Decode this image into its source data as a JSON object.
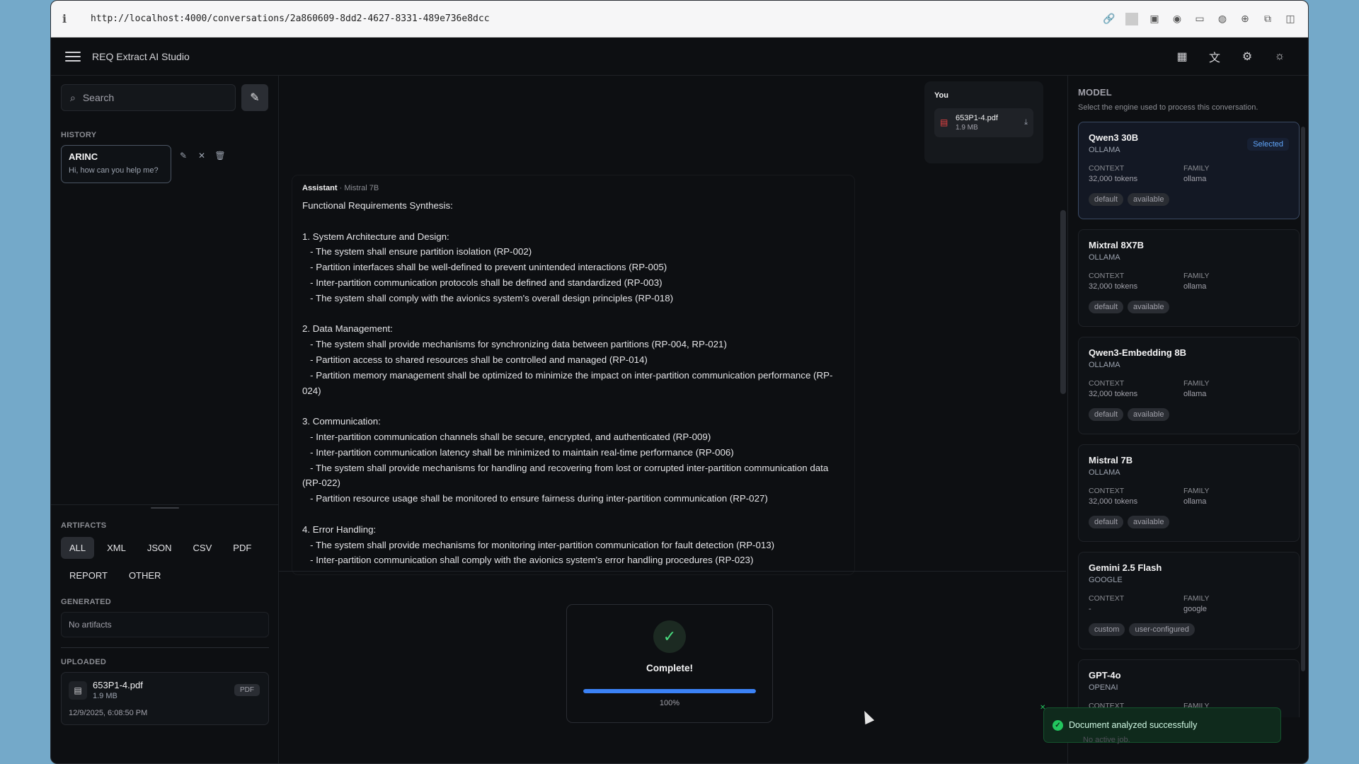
{
  "browser": {
    "url": "http://localhost:4000/conversations/2a860609-8dd2-4627-8331-489e736e8dcc"
  },
  "app": {
    "title": "REQ Extract AI Studio"
  },
  "sidebar": {
    "search_placeholder": "Search",
    "history_label": "HISTORY",
    "history": [
      {
        "title": "ARINC",
        "subtitle": "Hi, how can you help me?"
      }
    ],
    "artifacts_label": "ARTIFACTS",
    "filters": [
      "ALL",
      "XML",
      "JSON",
      "CSV",
      "PDF",
      "REPORT",
      "OTHER"
    ],
    "generated_label": "GENERATED",
    "generated_empty": "No artifacts",
    "uploaded_label": "UPLOADED",
    "uploaded": {
      "name": "653P1-4.pdf",
      "size": "1.9 MB",
      "type": "PDF",
      "date": "12/9/2025, 6:08:50 PM"
    }
  },
  "chat": {
    "you_label": "You",
    "attachment": {
      "name": "653P1-4.pdf",
      "size": "1.9 MB"
    },
    "assistant_label": "Assistant",
    "assistant_model": "· Mistral 7B",
    "assistant_text": "Functional Requirements Synthesis:\n\n1. System Architecture and Design:\n   - The system shall ensure partition isolation (RP-002)\n   - Partition interfaces shall be well-defined to prevent unintended interactions (RP-005)\n   - Inter-partition communication protocols shall be defined and standardized (RP-003)\n   - The system shall comply with the avionics system's overall design principles (RP-018)\n\n2. Data Management:\n   - The system shall provide mechanisms for synchronizing data between partitions (RP-004, RP-021)\n   - Partition access to shared resources shall be controlled and managed (RP-014)\n   - Partition memory management shall be optimized to minimize the impact on inter-partition communication performance (RP-024)\n\n3. Communication:\n   - Inter-partition communication channels shall be secure, encrypted, and authenticated (RP-009)\n   - Inter-partition communication latency shall be minimized to maintain real-time performance (RP-006)\n   - The system shall provide mechanisms for handling and recovering from lost or corrupted inter-partition communication data (RP-022)\n   - Partition resource usage shall be monitored to ensure fairness during inter-partition communication (RP-027)\n\n4. Error Handling:\n   - The system shall provide mechanisms for monitoring inter-partition communication for fault detection (RP-013)\n   - Inter-partition communication shall comply with the avionics system's error handling procedures (RP-023)",
    "progress": {
      "label": "Complete!",
      "percent": 100,
      "percent_text": "100%"
    }
  },
  "models": {
    "title": "MODEL",
    "subtitle": "Select the engine used to process this conversation.",
    "context_label": "CONTEXT",
    "family_label": "FAMILY",
    "selected_label": "Selected",
    "items": [
      {
        "name": "Qwen3 30B",
        "provider": "OLLAMA",
        "context": "32,000 tokens",
        "family": "ollama",
        "tags": [
          "default",
          "available"
        ],
        "selected": true
      },
      {
        "name": "Mixtral 8X7B",
        "provider": "OLLAMA",
        "context": "32,000 tokens",
        "family": "ollama",
        "tags": [
          "default",
          "available"
        ]
      },
      {
        "name": "Qwen3-Embedding 8B",
        "provider": "OLLAMA",
        "context": "32,000 tokens",
        "family": "ollama",
        "tags": [
          "default",
          "available"
        ]
      },
      {
        "name": "Mistral 7B",
        "provider": "OLLAMA",
        "context": "32,000 tokens",
        "family": "ollama",
        "tags": [
          "default",
          "available"
        ]
      },
      {
        "name": "Gemini 2.5 Flash",
        "provider": "GOOGLE",
        "context": "-",
        "family": "google",
        "tags": [
          "custom",
          "user-configured"
        ]
      },
      {
        "name": "GPT-4o",
        "provider": "OPENAI",
        "context": "",
        "family": "",
        "tags": []
      }
    ]
  },
  "toast": {
    "message": "Document analyzed successfully",
    "under": "No active job."
  },
  "colors": {
    "accent": "#3b82f6",
    "success": "#22c55e",
    "background": "#0d0f12"
  }
}
